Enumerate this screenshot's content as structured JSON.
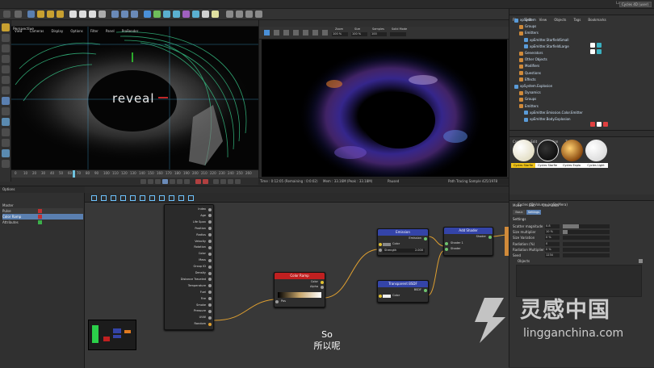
{
  "menu": [
    "File",
    "Edit",
    "Create",
    "Select",
    "Tools",
    "Mesh",
    "Volume",
    "Snap",
    "Animate",
    "Simulate",
    "Track",
    "Render",
    "Script",
    "Motion Tracker",
    "MoGraph",
    "Character",
    "Pipeline",
    "Plugins",
    "Cycles 4D",
    "X-Particles",
    "Script",
    "Window",
    "Help"
  ],
  "layout": {
    "label": "Layout:",
    "value": "Cycles 4D (user)"
  },
  "viewport1": {
    "menu": [
      "View",
      "Cameras",
      "Display",
      "Options",
      "Filter",
      "Panel",
      "ProRender"
    ],
    "label": "Perspective",
    "text": "reveal",
    "grid_spacing": "Grid Spacing : 500 cm"
  },
  "timeline": {
    "ticks": [
      "0",
      "10",
      "20",
      "30",
      "40",
      "50",
      "60",
      "70",
      "80",
      "90",
      "100",
      "110",
      "120",
      "130",
      "140",
      "150",
      "160",
      "170",
      "180",
      "190",
      "200",
      "210",
      "220",
      "230",
      "240",
      "250",
      "260"
    ]
  },
  "viewport2": {
    "menu": [
      "File",
      "Render",
      "Tools"
    ],
    "fields": [
      {
        "label": "Zoom",
        "value": "100 %"
      },
      {
        "label": "Size",
        "value": "100 %"
      },
      {
        "label": "Samples",
        "value": "100"
      },
      {
        "label": "Solid Mode",
        "value": ""
      }
    ]
  },
  "status": {
    "time": "Time : 0:12:05 (Remaining : 0:0:02)",
    "mem": "Mem : 33.16M (Peak : 33.18M)",
    "paused": "Paused",
    "path": "Path Tracing Sample 425/1978"
  },
  "objects": {
    "menu": [
      "File",
      "Edit",
      "View",
      "Objects",
      "Tags",
      "Bookmarks"
    ],
    "rows": [
      {
        "name": "xpSystem",
        "color": "#5a9bd8",
        "indent": 0
      },
      {
        "name": "Groups",
        "color": "#d08a3a",
        "indent": 1
      },
      {
        "name": "Emitters",
        "color": "#d08a3a",
        "indent": 1
      },
      {
        "name": "xpEmitter.StarfieldSmall",
        "color": "#5a9bd8",
        "indent": 2
      },
      {
        "name": "xpEmitter.StarfieldLarge",
        "color": "#5a9bd8",
        "indent": 2
      },
      {
        "name": "Generators",
        "color": "#d08a3a",
        "indent": 1
      },
      {
        "name": "Other Objects",
        "color": "#d08a3a",
        "indent": 1
      },
      {
        "name": "Modifiers",
        "color": "#d08a3a",
        "indent": 1
      },
      {
        "name": "Questions",
        "color": "#d08a3a",
        "indent": 1
      },
      {
        "name": "Effects",
        "color": "#d08a3a",
        "indent": 1
      },
      {
        "name": "xpSystem.Explosion",
        "color": "#5a9bd8",
        "indent": 0
      },
      {
        "name": "Dynamics",
        "color": "#d08a3a",
        "indent": 1
      },
      {
        "name": "Groups",
        "color": "#d08a3a",
        "indent": 1
      },
      {
        "name": "Emitters",
        "color": "#d08a3a",
        "indent": 1
      },
      {
        "name": "xpEmitter.Emission.Color.Emitter",
        "color": "#5a9bd8",
        "indent": 2
      },
      {
        "name": "xpEmitter.Body.Explosion",
        "color": "#5a9bd8",
        "indent": 2
      }
    ]
  },
  "materials": {
    "menu": [
      "Create",
      "Edit",
      "Function",
      "Texture"
    ],
    "items": [
      {
        "label": "Cycles Starfie",
        "color": "#f1ecd6",
        "tag": "#f0c419"
      },
      {
        "label": "Cycles Starfie",
        "color": "#111111",
        "tag": "#ffffff"
      },
      {
        "label": "Cycles Explo",
        "color": "#f0a33a",
        "tag": "#ffffff"
      },
      {
        "label": "Cycles Light",
        "color": "#f4f4f4",
        "tag": "#ffffff"
      }
    ]
  },
  "attributes": {
    "menu": [
      "Mode",
      "Edit",
      "User Data"
    ],
    "title": "Cycles 4D Volume (xpSteMera)",
    "tabs": [
      "Basic",
      "Settings"
    ],
    "section": "Settings",
    "rows": [
      {
        "label": "Scatter magnitude",
        "value": "0.8",
        "fill": 0.35
      },
      {
        "label": "Size multiplier",
        "value": "10 %",
        "fill": 0.1
      },
      {
        "label": "Size Variation",
        "value": "0 %",
        "fill": 0
      },
      {
        "label": "Radiation (%)",
        "value": "0",
        "fill": 0
      },
      {
        "label": "Radiation Multiplier",
        "value": "0 %",
        "fill": 0
      },
      {
        "label": "Seed",
        "value": "1234",
        "fill": 0
      }
    ],
    "objects_label": "Objects"
  },
  "xpresso": {
    "panel_title": "Options",
    "left_header": "Master",
    "left_rows": [
      {
        "label": "Pulse",
        "color": "#c03030"
      },
      {
        "label": "Color Ramp",
        "color": "#c03030"
      },
      {
        "label": "Attributes",
        "color": "#3bb04a"
      }
    ],
    "particle_ports": [
      "Index",
      "Age",
      "Life Span",
      "Position",
      "Radius",
      "Velocity",
      "Rotation",
      "Color",
      "Mass",
      "Group ID",
      "Density",
      "Distance Traveled",
      "Temperature",
      "Fuel",
      "Fire",
      "Smoke",
      "Pressure",
      "UVW",
      "Random"
    ],
    "color_ramp": {
      "title": "Color Ramp",
      "outs": [
        "Color",
        "Alpha"
      ],
      "in": "Pos"
    },
    "emission": {
      "title": "Emission",
      "out": "Emission",
      "ins": [
        "Color",
        "Strength"
      ],
      "strength": "2.000"
    },
    "transparent": {
      "title": "Transparent BSDF",
      "out": "BSDF",
      "in": "Color"
    },
    "add_shader": {
      "title": "Add Shader",
      "out": "Shader",
      "ins": [
        "Shader 1",
        "Shader"
      ]
    }
  },
  "subtitle": {
    "line1": "So",
    "line2": "所以呢"
  },
  "watermark": {
    "text": "灵感中国",
    "url": "lingganchina.com"
  }
}
